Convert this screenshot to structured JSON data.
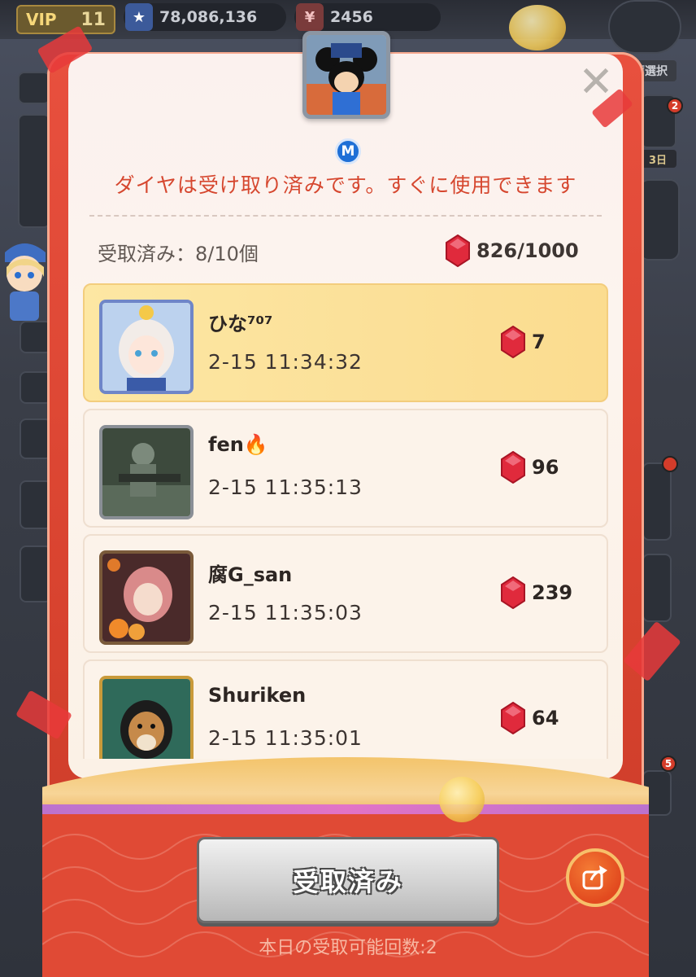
{
  "topbar": {
    "vip_label": "VIP",
    "vip_level": "11",
    "power_value": "78,086,136",
    "currency_icon": "¥",
    "currency_value": "2456"
  },
  "side": {
    "tag_label": "薦選択",
    "day_label": "3日",
    "badge_2": "2",
    "badge_5": "5"
  },
  "modal": {
    "m_badge": "M",
    "notice": "ダイヤは受け取り済みです。すぐに使用できます",
    "claimed_label": "受取済み：8/10個",
    "total_gems": "826/1000",
    "close_symbol": "✕"
  },
  "claims": [
    {
      "name": "ひな⁷⁰⁷",
      "time": "2-15 11:34:32",
      "amount": "7"
    },
    {
      "name": "fen🔥",
      "time": "2-15 11:35:13",
      "amount": "96"
    },
    {
      "name": "腐G_san",
      "time": "2-15 11:35:03",
      "amount": "239"
    },
    {
      "name": "Shuriken",
      "time": "2-15 11:35:01",
      "amount": "64"
    }
  ],
  "bottom": {
    "claim_button": "受取済み",
    "remaining": "本日の受取可能回数:2"
  },
  "colors": {
    "accent_red": "#e04a35",
    "notice_red": "#d6472f",
    "gem_red": "#e02a3c",
    "highlight_row": "#fde7a3"
  }
}
